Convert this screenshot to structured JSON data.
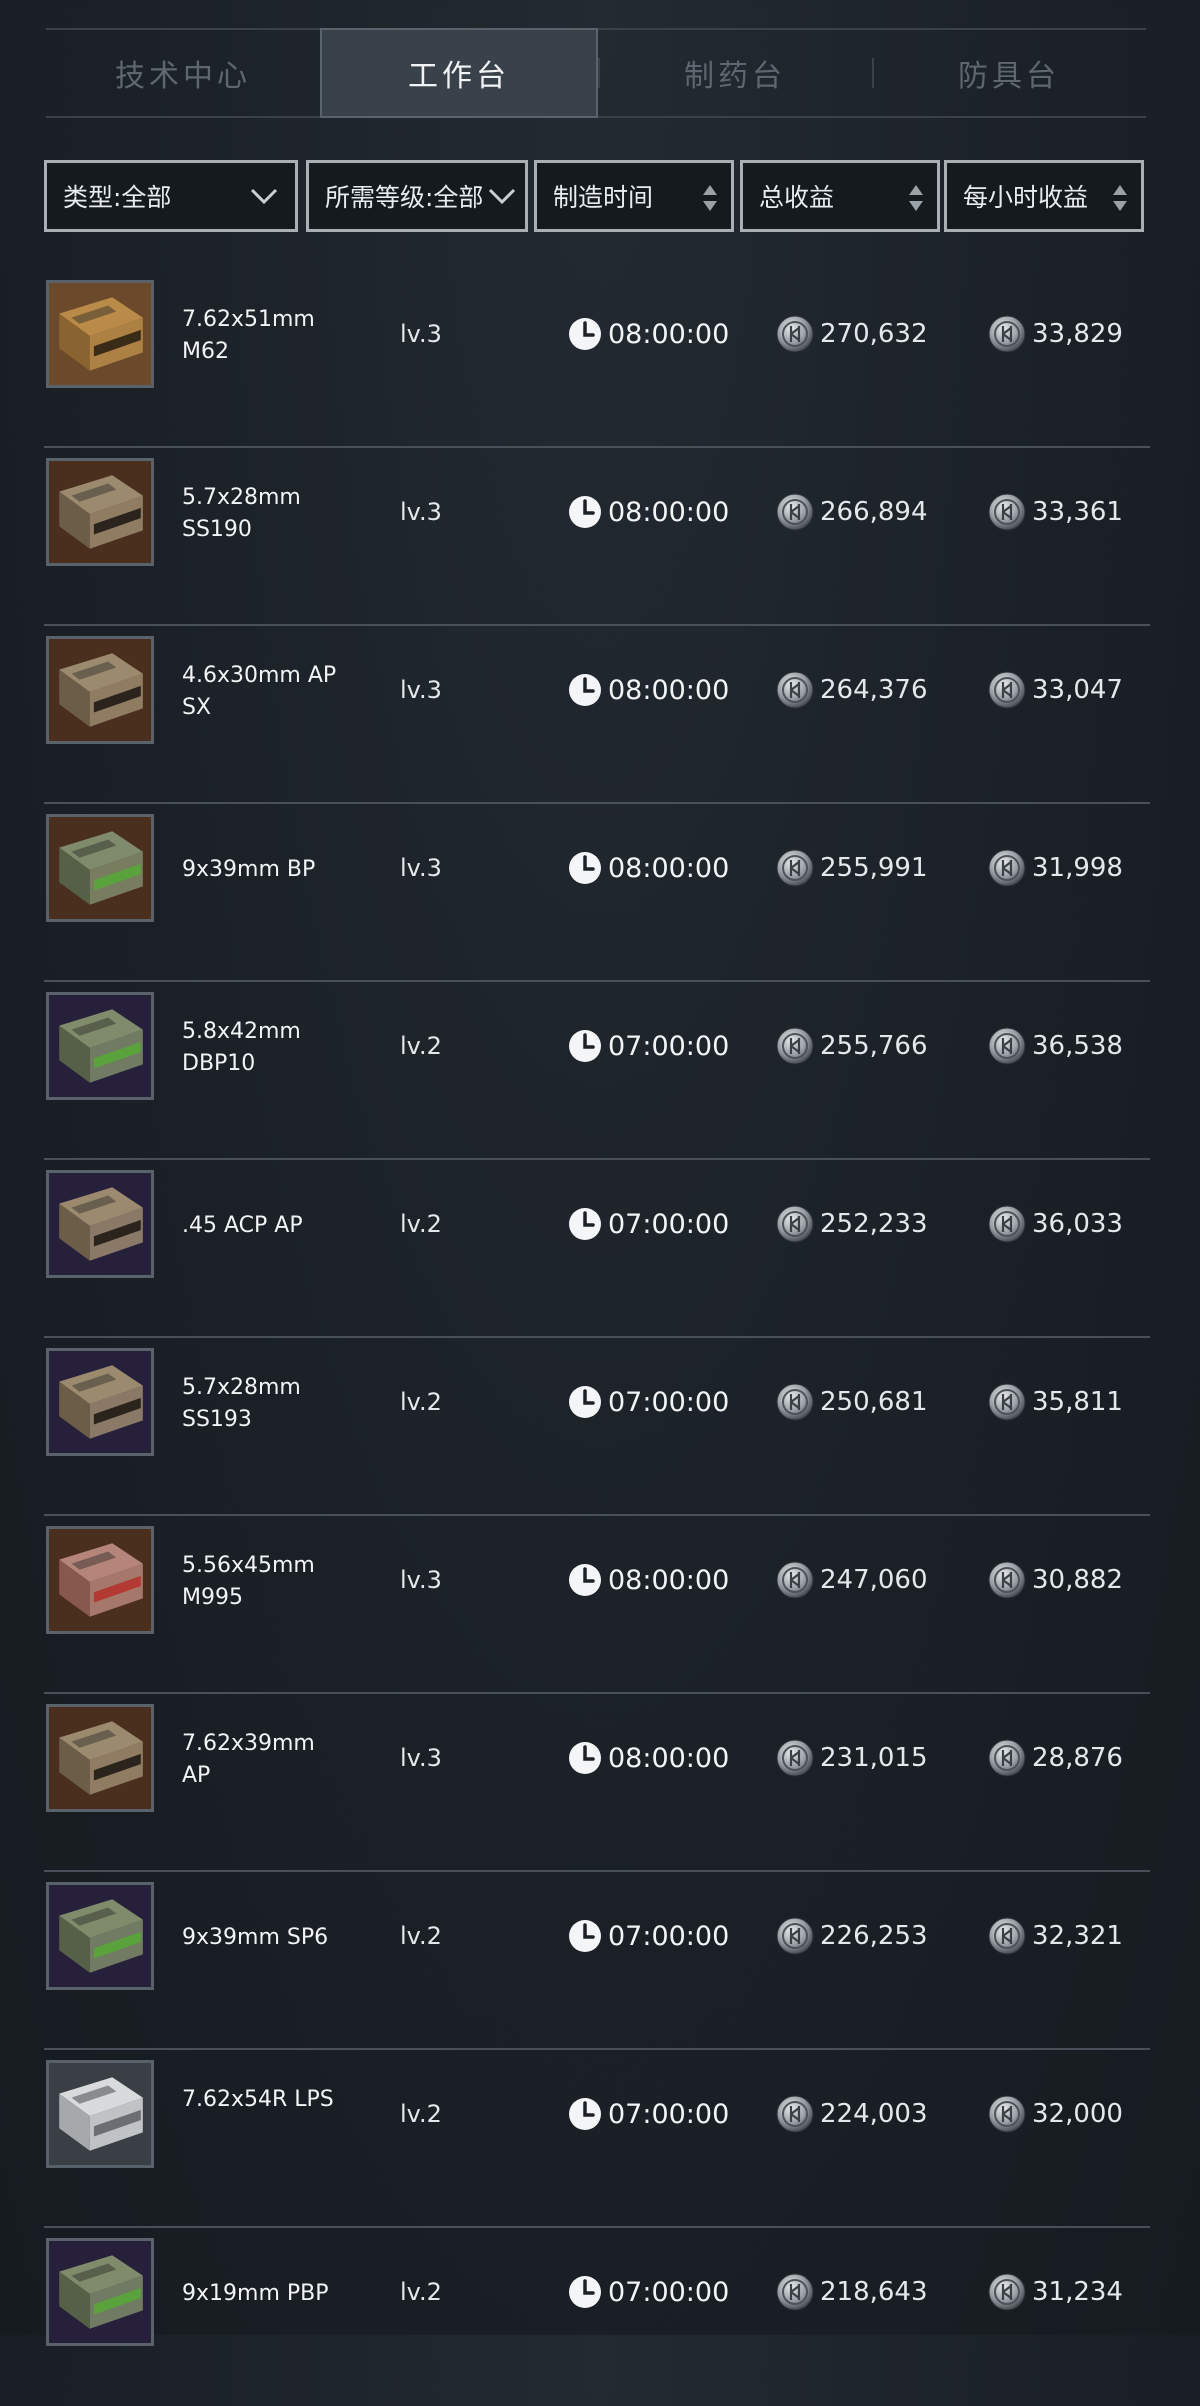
{
  "tabs": [
    {
      "label": "技术中心",
      "active": false
    },
    {
      "label": "工作台",
      "active": true
    },
    {
      "label": "制药台",
      "active": false
    },
    {
      "label": "防具台",
      "active": false
    }
  ],
  "filters": {
    "type": "类型:全部",
    "level": "所需等级:全部",
    "time": "制造时间",
    "total": "总收益",
    "hourly": "每小时收益"
  },
  "icons": {
    "clock": "clock-icon",
    "coin": "coin-icon",
    "dropdown": "chevron-down-icon",
    "sort": "sort-icon"
  },
  "colors": {
    "accent_active_tab": "#39424b",
    "text": "#f2f4f5",
    "divider": "#48515a"
  },
  "items": [
    {
      "name": "7.62x51mm M62",
      "level": "lv.3",
      "time": "08:00:00",
      "total": "270,632",
      "hourly": "33,829",
      "box": "tan"
    },
    {
      "name": "5.7x28mm SS190",
      "level": "lv.3",
      "time": "08:00:00",
      "total": "266,894",
      "hourly": "33,361",
      "box": "brown"
    },
    {
      "name": "4.6x30mm AP SX",
      "level": "lv.3",
      "time": "08:00:00",
      "total": "264,376",
      "hourly": "33,047",
      "box": "brown"
    },
    {
      "name": "9x39mm BP",
      "level": "lv.3",
      "time": "08:00:00",
      "total": "255,991",
      "hourly": "31,998",
      "box": "green-brown"
    },
    {
      "name": "5.8x42mm DBP10",
      "level": "lv.2",
      "time": "07:00:00",
      "total": "255,766",
      "hourly": "36,538",
      "box": "green-purple"
    },
    {
      "name": ".45 ACP AP",
      "level": "lv.2",
      "time": "07:00:00",
      "total": "252,233",
      "hourly": "36,033",
      "box": "purple"
    },
    {
      "name": "5.7x28mm SS193",
      "level": "lv.2",
      "time": "07:00:00",
      "total": "250,681",
      "hourly": "35,811",
      "box": "purple"
    },
    {
      "name": "5.56x45mm M995",
      "level": "lv.3",
      "time": "08:00:00",
      "total": "247,060",
      "hourly": "30,882",
      "box": "red"
    },
    {
      "name": "7.62x39mm AP",
      "level": "lv.3",
      "time": "08:00:00",
      "total": "231,015",
      "hourly": "28,876",
      "box": "brown"
    },
    {
      "name": "9x39mm SP6",
      "level": "lv.2",
      "time": "07:00:00",
      "total": "226,253",
      "hourly": "32,321",
      "box": "green-purple"
    },
    {
      "name": "7.62x54R LPS",
      "level": "lv.2",
      "time": "07:00:00",
      "total": "224,003",
      "hourly": "32,000",
      "box": "white"
    },
    {
      "name": "9x19mm PBP",
      "level": "lv.2",
      "time": "07:00:00",
      "total": "218,643",
      "hourly": "31,234",
      "box": "green-purple"
    }
  ]
}
